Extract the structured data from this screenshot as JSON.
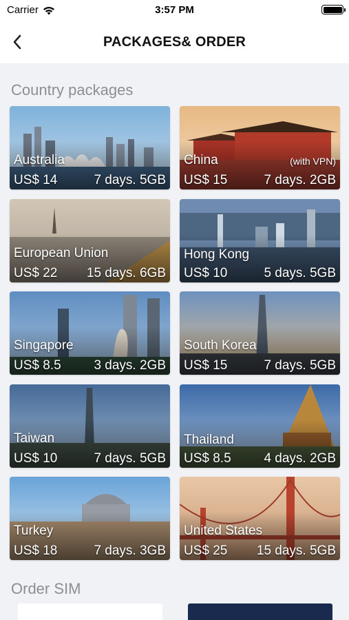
{
  "status_bar": {
    "carrier": "Carrier",
    "time": "3:57 PM"
  },
  "nav": {
    "title": "PACKAGES& ORDER",
    "back_icon": "chevron-left-icon"
  },
  "sections": {
    "country_packages": "Country packages",
    "order_sim": "Order SIM"
  },
  "packages": [
    {
      "country": "Australia",
      "note": "",
      "price": "US$ 14",
      "detail": "7 days. 5GB"
    },
    {
      "country": "China",
      "note": "(with VPN)",
      "price": "US$ 15",
      "detail": "7 days. 2GB"
    },
    {
      "country": "European Union",
      "note": "",
      "price": "US$ 22",
      "detail": "15 days. 6GB"
    },
    {
      "country": "Hong Kong",
      "note": "",
      "price": "US$ 10",
      "detail": "5 days. 5GB"
    },
    {
      "country": "Singapore",
      "note": "",
      "price": "US$ 8.5",
      "detail": "3 days. 2GB"
    },
    {
      "country": "South Korea",
      "note": "",
      "price": "US$ 15",
      "detail": "7 days. 5GB"
    },
    {
      "country": "Taiwan",
      "note": "",
      "price": "US$ 10",
      "detail": "7 days. 5GB"
    },
    {
      "country": "Thailand",
      "note": "",
      "price": "US$ 8.5",
      "detail": "4 days. 2GB"
    },
    {
      "country": "Turkey",
      "note": "",
      "price": "US$ 18",
      "detail": "7 days. 3GB"
    },
    {
      "country": "United States",
      "note": "",
      "price": "US$ 25",
      "detail": "15 days. 5GB"
    }
  ],
  "colors": {
    "background": "#f1f2f6",
    "section_title": "#8d8e93",
    "sim_dark": "#1a2a4f"
  }
}
